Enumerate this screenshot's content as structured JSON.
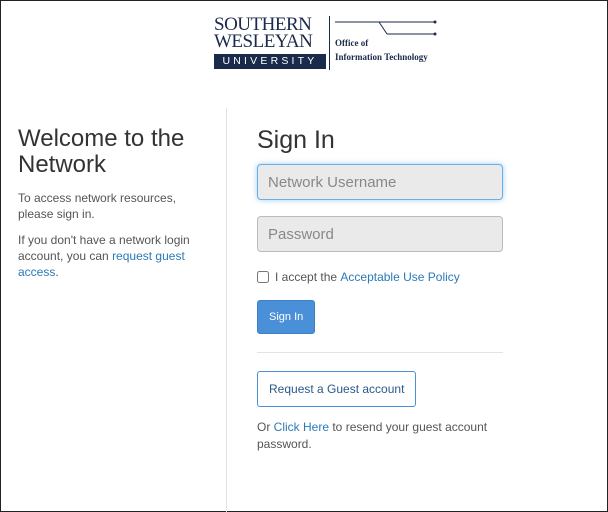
{
  "header": {
    "logo_word1": "SOUTHERN",
    "logo_word2": "WESLEYAN",
    "logo_univ": "UNIVERSITY",
    "oit_line1": "Office of",
    "oit_line2": "Information Technology",
    "logo_color": "#1a2a4a"
  },
  "welcome": {
    "title": "Welcome to the Network",
    "para1": "To access network resources, please sign in.",
    "para2_prefix": "If you don't have a network login account, you can ",
    "para2_link": "request guest access",
    "para2_suffix": "."
  },
  "signin": {
    "title": "Sign In",
    "username_placeholder": "Network Username",
    "username_value": "",
    "password_placeholder": "Password",
    "password_value": "",
    "accept_prefix": "I accept the ",
    "accept_link": "Acceptable Use Policy",
    "accept_checked": false,
    "signin_button": "Sign In",
    "guest_button": "Request a Guest account",
    "resend_prefix": "Or ",
    "resend_link": "Click Here",
    "resend_suffix": " to resend your guest account password."
  },
  "colors": {
    "primary": "#4a90d9",
    "link": "#2a7ab8",
    "focus": "#66afe9"
  }
}
